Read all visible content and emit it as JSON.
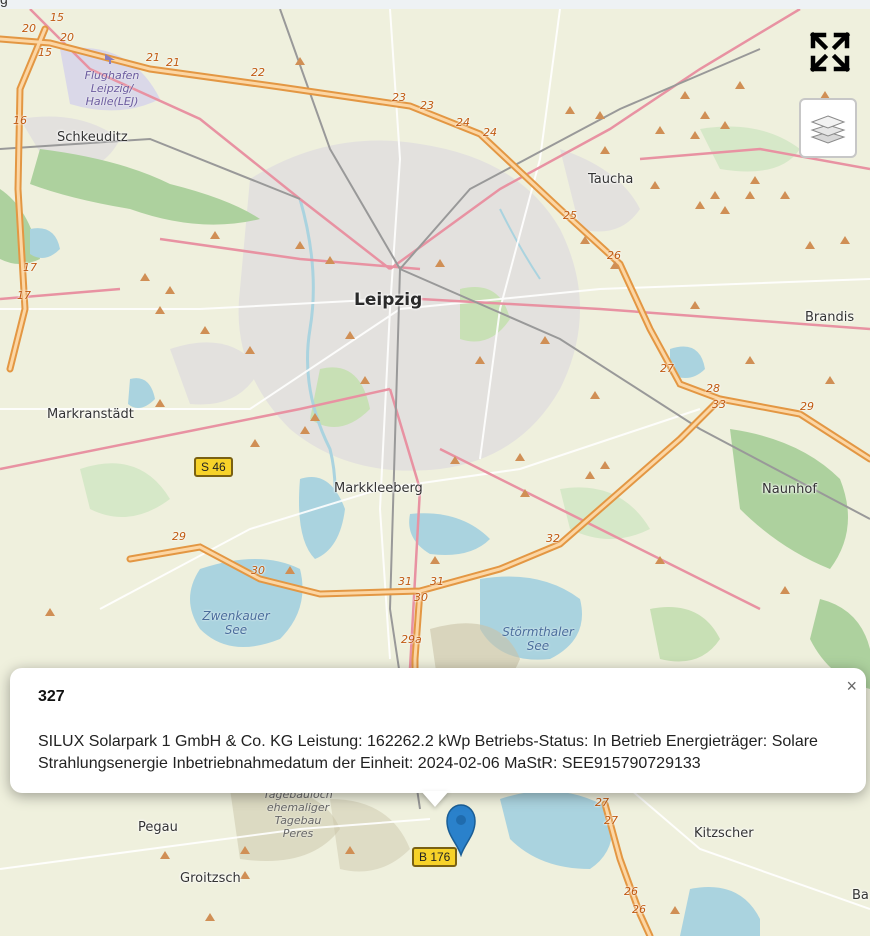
{
  "top_strip_text": "g",
  "controls": {
    "fullscreen_icon": "expand-arrows-icon",
    "layers_icon": "layers-icon"
  },
  "places": {
    "leipzig": "Leipzig",
    "schkeuditz": "Schkeuditz",
    "taucha": "Taucha",
    "brandis": "Brandis",
    "markranstaedt": "Markranstädt",
    "markkleeberg": "Markkleeberg",
    "naunhof": "Naunhof",
    "pegau": "Pegau",
    "groitzsch": "Groitzsch",
    "kitzscher": "Kitzscher",
    "ba": "Ba"
  },
  "water_labels": {
    "zwenkauer": [
      "Zwenkauer",
      "See"
    ],
    "stoermthaler": [
      "Störmthaler",
      "See"
    ]
  },
  "airport_label": [
    "Flughafen",
    "Leipzig/",
    "Halle(LEJ)"
  ],
  "mine_label": [
    "Tagebauloch",
    "ehemaliger",
    "Tagebau",
    "Peres"
  ],
  "road_signs": {
    "s46": "S 46",
    "b176": "B 176"
  },
  "exits": [
    "20",
    "15",
    "20",
    "15",
    "21",
    "21",
    "22",
    "23",
    "23",
    "24",
    "24",
    "25",
    "26",
    "27",
    "28",
    "33",
    "29",
    "16",
    "17",
    "17",
    "29",
    "30",
    "31",
    "31",
    "30",
    "32",
    "29a",
    "27",
    "27",
    "26",
    "26"
  ],
  "popup": {
    "title": "327",
    "body": "SILUX Solarpark 1 GmbH & Co. KG Leistung: 162262.2 kWp Betriebs-Status: In Betrieb Energieträger: Solare Strahlungsenergie Inbetriebnahmedatum der Einheit: 2024-02-06 MaStR: SEE915790729133",
    "close": "×"
  },
  "colors": {
    "motorway": "#e892a2",
    "trunk": "#f9b29c",
    "highway_orange": "#f7a844",
    "water": "#aad3df",
    "forest": "#add19e",
    "urban": "#e0dfdf",
    "marker": "#2a81cb"
  }
}
